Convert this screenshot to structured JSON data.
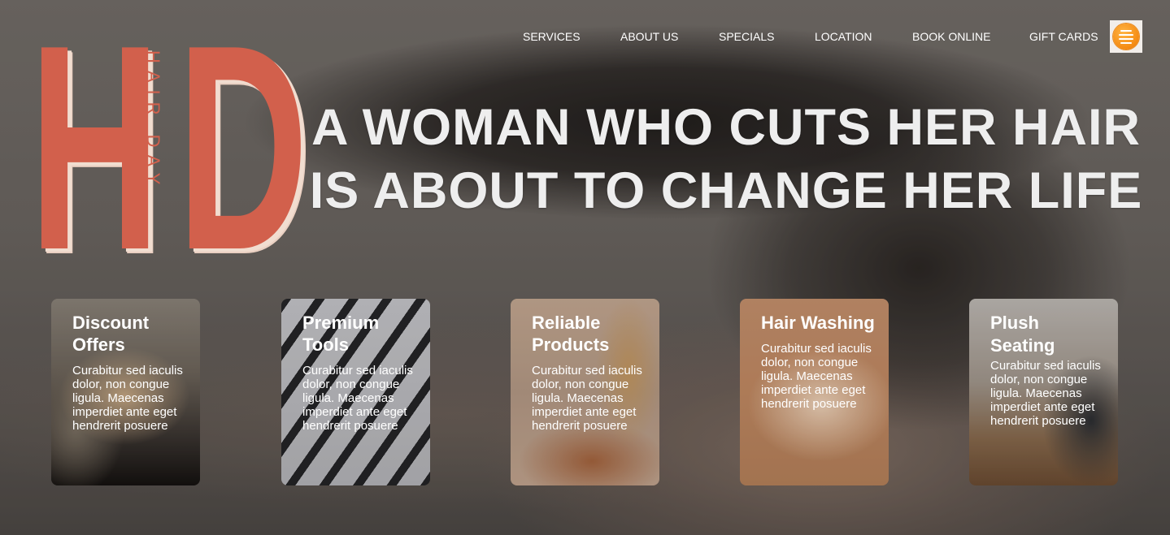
{
  "logo": {
    "letters": [
      "H",
      "D"
    ],
    "tagline": "HAIR DAY",
    "color": "#d2604c"
  },
  "nav": {
    "items": [
      "SERVICES",
      "ABOUT US",
      "SPECIALS",
      "LOCATION",
      "BOOK ONLINE",
      "GIFT CARDS"
    ],
    "menu_icon": "hamburger-icon",
    "menu_color": "#f48a12"
  },
  "hero": {
    "headline_line1": "A WOMAN WHO CUTS HER HAIR",
    "headline_line2": "IS ABOUT TO CHANGE HER LIFE"
  },
  "cards": [
    {
      "title": "Discount Offers",
      "text": "Curabitur sed iaculis dolor, non congue ligula. Maecenas imperdiet ante eget hendrerit posuere"
    },
    {
      "title": "Premium Tools",
      "text": "Curabitur sed iaculis dolor, non congue ligula. Maecenas imperdiet ante eget hendrerit posuere"
    },
    {
      "title": "Reliable Products",
      "text": "Curabitur sed iaculis dolor, non congue ligula. Maecenas imperdiet ante eget hendrerit posuere"
    },
    {
      "title": "Hair Washing",
      "text": "Curabitur sed iaculis dolor, non congue ligula. Maecenas imperdiet ante eget hendrerit posuere"
    },
    {
      "title": "Plush Seating",
      "text": "Curabitur sed iaculis dolor, non congue ligula. Maecenas imperdiet ante eget hendrerit posuere"
    }
  ]
}
